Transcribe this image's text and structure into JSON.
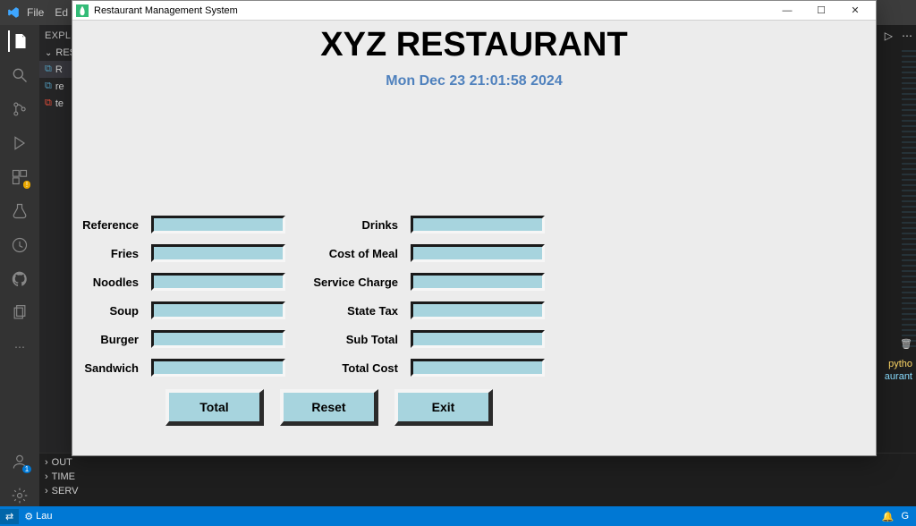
{
  "vscode": {
    "menu": [
      "File",
      "Ed"
    ],
    "explorer_label": "EXPL",
    "folder_label": "REST",
    "files": {
      "f0": "R",
      "f1": "re",
      "f2": "te"
    },
    "panel": {
      "outline": "OUT",
      "timeline": "TIME",
      "servers": "SERV"
    },
    "statusbar_left": "Lau",
    "statusbar_right": "G",
    "run_icon_text": "▷",
    "trash_icon_text": "…",
    "term_line1": "pytho",
    "term_line2": "aurant"
  },
  "tk": {
    "window_title": "Restaurant Management System",
    "title": "XYZ RESTAURANT",
    "datetime": "Mon Dec 23 21:01:58 2024",
    "labels": {
      "reference": "Reference",
      "fries": "Fries",
      "noodles": "Noodles",
      "soup": "Soup",
      "burger": "Burger",
      "sandwich": "Sandwich",
      "drinks": "Drinks",
      "cost_of_meal": "Cost of Meal",
      "service_charge": "Service Charge",
      "state_tax": "State Tax",
      "sub_total": "Sub Total",
      "total_cost": "Total Cost"
    },
    "values": {
      "reference": "",
      "fries": "",
      "noodles": "",
      "soup": "",
      "burger": "",
      "sandwich": "",
      "drinks": "",
      "cost_of_meal": "",
      "service_charge": "",
      "state_tax": "",
      "sub_total": "",
      "total_cost": ""
    },
    "buttons": {
      "total": "Total",
      "reset": "Reset",
      "exit": "Exit"
    }
  }
}
